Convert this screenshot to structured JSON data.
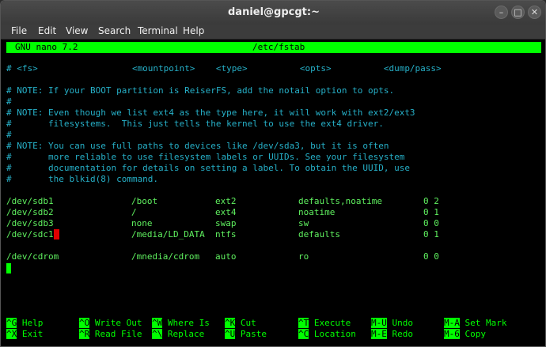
{
  "window": {
    "title": "daniel@gpcgt:~",
    "buttons": {
      "minimize": "–",
      "maximize": "□",
      "close": "✕"
    }
  },
  "menu": [
    "File",
    "Edit",
    "View",
    "Search",
    "Terminal",
    "Help"
  ],
  "nano": {
    "version": "GNU nano 7.2",
    "filename": "/etc/fstab"
  },
  "header_comment": "# <fs>                  <mountpoint>    <type>          <opts>          <dump/pass>",
  "comments": [
    "# NOTE: If your BOOT partition is ReiserFS, add the notail option to opts.",
    "#",
    "# NOTE: Even though we list ext4 as the type here, it will work with ext2/ext3",
    "#       filesystems.  This just tells the kernel to use the ext4 driver.",
    "#",
    "# NOTE: You can use full paths to devices like /dev/sda3, but it is often",
    "#       more reliable to use filesystem labels or UUIDs. See your filesystem",
    "#       documentation for details on setting a label. To obtain the UUID, use",
    "#       the blkid(8) command."
  ],
  "entries": [
    {
      "fs": "/dev/sdb1",
      "mount": "/boot",
      "type": "ext2",
      "opts": "defaults,noatime",
      "dump": "0 2"
    },
    {
      "fs": "/dev/sdb2",
      "mount": "/",
      "type": "ext4",
      "opts": "noatime",
      "dump": "0 1"
    },
    {
      "fs": "/dev/sdb3",
      "mount": "none",
      "type": "swap",
      "opts": "sw",
      "dump": "0 0"
    },
    {
      "fs": "/dev/sdc1",
      "mount": "/media/LD_DATA",
      "type": "ntfs",
      "opts": "defaults",
      "dump": "0 1"
    },
    {
      "fs": "/dev/cdrom",
      "mount": "/mnedia/cdrom",
      "type": "auto",
      "opts": "ro",
      "dump": "0 0"
    }
  ],
  "shortcuts": [
    [
      {
        "key": "^G",
        "label": "Help"
      },
      {
        "key": "^O",
        "label": "Write Out"
      },
      {
        "key": "^W",
        "label": "Where Is"
      },
      {
        "key": "^K",
        "label": "Cut"
      },
      {
        "key": "^T",
        "label": "Execute"
      },
      {
        "key": "M-U",
        "label": "Undo"
      },
      {
        "key": "M-A",
        "label": "Set Mark"
      }
    ],
    [
      {
        "key": "^X",
        "label": "Exit"
      },
      {
        "key": "^R",
        "label": "Read File"
      },
      {
        "key": "^\\",
        "label": "Replace"
      },
      {
        "key": "^U",
        "label": "Paste"
      },
      {
        "key": "^C",
        "label": "Location"
      },
      {
        "key": "M-E",
        "label": "Redo"
      },
      {
        "key": "M-6",
        "label": "Copy"
      }
    ]
  ],
  "colors": {
    "accent": "#00ff00",
    "comment": "#26b0c8",
    "cursor": "#e00000"
  }
}
